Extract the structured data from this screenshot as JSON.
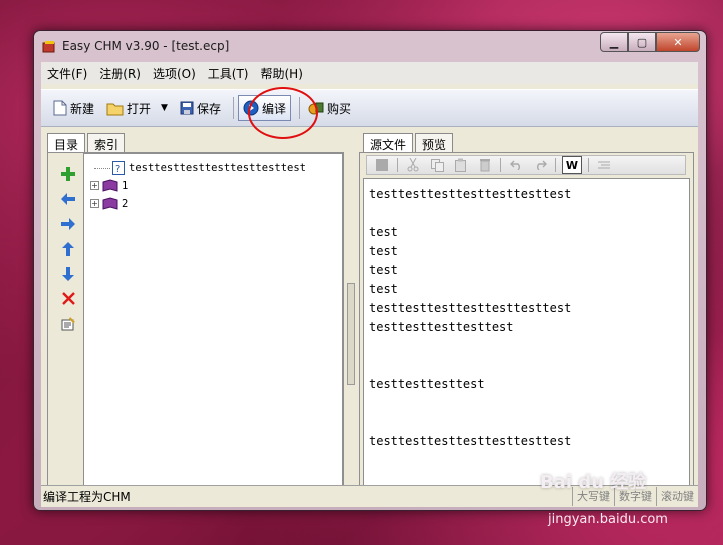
{
  "window": {
    "title": "Easy CHM v3.90 - [test.ecp]",
    "min_glyph": "▁",
    "max_glyph": "▢",
    "close_glyph": "✕"
  },
  "menu": [
    {
      "label": "文件(F)"
    },
    {
      "label": "注册(R)"
    },
    {
      "label": "选项(O)"
    },
    {
      "label": "工具(T)"
    },
    {
      "label": "帮助(H)"
    }
  ],
  "toolbar": {
    "new_label": "新建",
    "open_label": "打开",
    "dropdown_glyph": "▼",
    "save_label": "保存",
    "compile_label": "编译",
    "buy_label": "购买"
  },
  "left_tabs": [
    {
      "label": "目录",
      "selected": true
    },
    {
      "label": "索引",
      "selected": false
    }
  ],
  "tree": {
    "root": "testtesttesttesttesttesttest",
    "expand_glyph": "+",
    "children": [
      {
        "label": "1"
      },
      {
        "label": "2"
      }
    ]
  },
  "right_tabs": [
    {
      "label": "源文件",
      "selected": true
    },
    {
      "label": "预览",
      "selected": false
    }
  ],
  "editor": {
    "wrap_label": "W",
    "lines": [
      "testtesttesttesttesttesttest",
      "",
      "test",
      "test",
      "test",
      "test",
      "testtesttesttesttesttesttest",
      "testtesttesttesttest",
      "",
      "",
      "testtesttesttest",
      "",
      "",
      "testtesttesttesttesttesttest"
    ]
  },
  "status": {
    "text": "编译工程为CHM",
    "caps": "大写键",
    "num": "数字键",
    "scroll": "滚动键"
  },
  "watermark": {
    "brand": "Bai du 经验",
    "url": "jingyan.baidu.com"
  },
  "colors": {
    "annotation": "#e01010",
    "accent": "#1f5fbf"
  }
}
